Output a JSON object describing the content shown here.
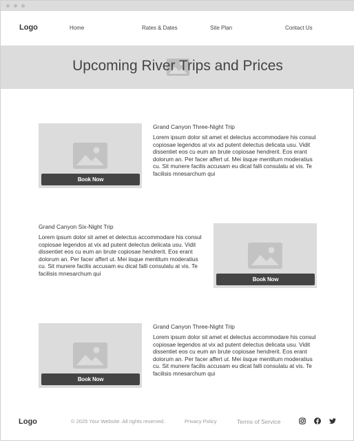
{
  "nav": {
    "logo": "Logo",
    "links": [
      "Home",
      "Rates & Dates",
      "Site Plan",
      "Contact Us"
    ]
  },
  "hero": {
    "title": "Upcoming River Trips and Prices"
  },
  "trips": [
    {
      "title": "Grand Canyon Three-Night Trip",
      "body": "Lorem ipsum dolor sit amet et delectus accommodare his consul copiosae legendos at vix ad putent delectus delicata usu. Vidit dissentiet eos cu eum an brute copiosae hendrerit. Eos erant dolorum an. Per facer affert ut. Mei iisque mentitum moderatius cu. Sit munere facilis accusam eu dicat falli consulatu at vis. Te facilisis mnesarchum qui",
      "button": "Book Now"
    },
    {
      "title": "Grand Canyon Six-Night Trip",
      "body": "Lorem ipsum dolor sit amet et delectus accommodare his consul copiosae legendos at vix ad putent delectus delicata usu. Vidit dissentiet eos cu eum an brute copiosae hendrerit. Eos erant dolorum an. Per facer affert ut. Mei iisque mentitum moderatius cu. Sit munere facilis accusam eu dicat falli consulatu at vis. Te facilisis mnesarchum qui",
      "button": "Book Now"
    },
    {
      "title": "Grand Canyon Three-Night Trip",
      "body": "Lorem ipsum dolor sit amet et delectus accommodare his consul copiosae legendos at vix ad putent delectus delicata usu. Vidit dissentiet eos cu eum an brute copiosae hendrerit. Eos erant dolorum an. Per facer affert ut. Mei iisque mentitum moderatius cu. Sit munere facilis accusam eu dicat falli consulatu at vis. Te facilisis mnesarchum qui",
      "button": "Book Now"
    }
  ],
  "footer": {
    "logo": "Logo",
    "copyright": "© 2025 Your Website. All rights reserved.",
    "privacy": "Privacy Policy",
    "terms": "Terms of Service",
    "social_icons": [
      "instagram-icon",
      "facebook-icon",
      "twitter-icon"
    ]
  },
  "colors": {
    "placeholder_gray": "#dcdcdc",
    "button_dark": "#444444",
    "hero_bg": "#dcdcdc"
  }
}
